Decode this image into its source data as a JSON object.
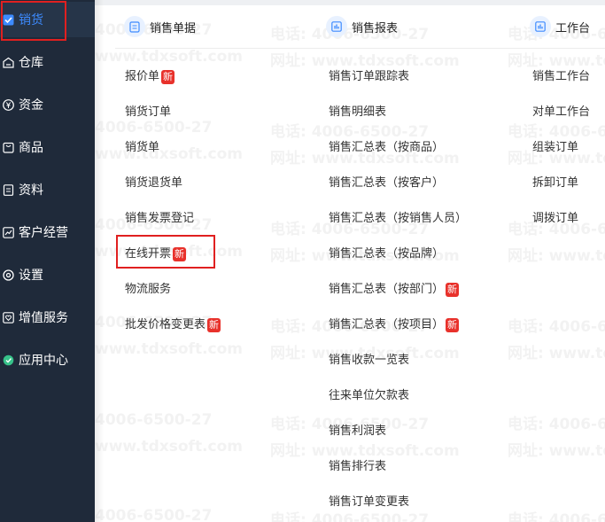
{
  "sidebar": {
    "items": [
      {
        "label": "销货",
        "icon": "sales-icon",
        "active": true
      },
      {
        "label": "仓库",
        "icon": "warehouse-icon"
      },
      {
        "label": "资金",
        "icon": "yen-icon"
      },
      {
        "label": "商品",
        "icon": "goods-icon"
      },
      {
        "label": "资料",
        "icon": "document-icon"
      },
      {
        "label": "客户经营",
        "icon": "chart-trend-icon"
      },
      {
        "label": "设置",
        "icon": "settings-icon"
      },
      {
        "label": "增值服务",
        "icon": "heart-icon"
      },
      {
        "label": "应用中心",
        "icon": "app-center-icon"
      }
    ]
  },
  "columns": {
    "sales_docs": {
      "title": "销售单据",
      "icon": "document-icon",
      "items": [
        {
          "label": "报价单",
          "badge": "新"
        },
        {
          "label": "销货订单"
        },
        {
          "label": "销货单"
        },
        {
          "label": "销货退货单"
        },
        {
          "label": "销售发票登记"
        },
        {
          "label": "在线开票",
          "badge": "新"
        },
        {
          "label": "物流服务"
        },
        {
          "label": "批发价格变更表",
          "badge": "新"
        }
      ]
    },
    "sales_reports": {
      "title": "销售报表",
      "icon": "report-icon",
      "items": [
        {
          "label": "销售订单跟踪表"
        },
        {
          "label": "销售明细表"
        },
        {
          "label": "销售汇总表（按商品）"
        },
        {
          "label": "销售汇总表（按客户）"
        },
        {
          "label": "销售汇总表（按销售人员）"
        },
        {
          "label": "销售汇总表（按品牌）"
        },
        {
          "label": "销售汇总表（按部门）",
          "badge": "新"
        },
        {
          "label": "销售汇总表（按项目）",
          "badge": "新"
        },
        {
          "label": "销售收款一览表"
        },
        {
          "label": "往来单位欠款表"
        },
        {
          "label": "销售利润表"
        },
        {
          "label": "销售排行表"
        },
        {
          "label": "销售订单变更表"
        }
      ]
    },
    "workbench": {
      "title": "工作台",
      "icon": "workbench-icon",
      "items": [
        {
          "label": "销售工作台"
        },
        {
          "label": "对单工作台"
        },
        {
          "label": "组装订单"
        },
        {
          "label": "拆卸订单"
        },
        {
          "label": "调拨订单"
        }
      ]
    }
  },
  "watermark": {
    "phone": "电话: 4006-6500-27",
    "phone_partial": "4006-6500-27",
    "site": "网址: www.tdxsoft.com",
    "site_partial": "www.tdxsoft.com"
  },
  "colors": {
    "sidebar_bg": "#1f2a3a",
    "active_text": "#3d8bff",
    "badge": "#e8312b",
    "highlight_box": "#e02020"
  }
}
